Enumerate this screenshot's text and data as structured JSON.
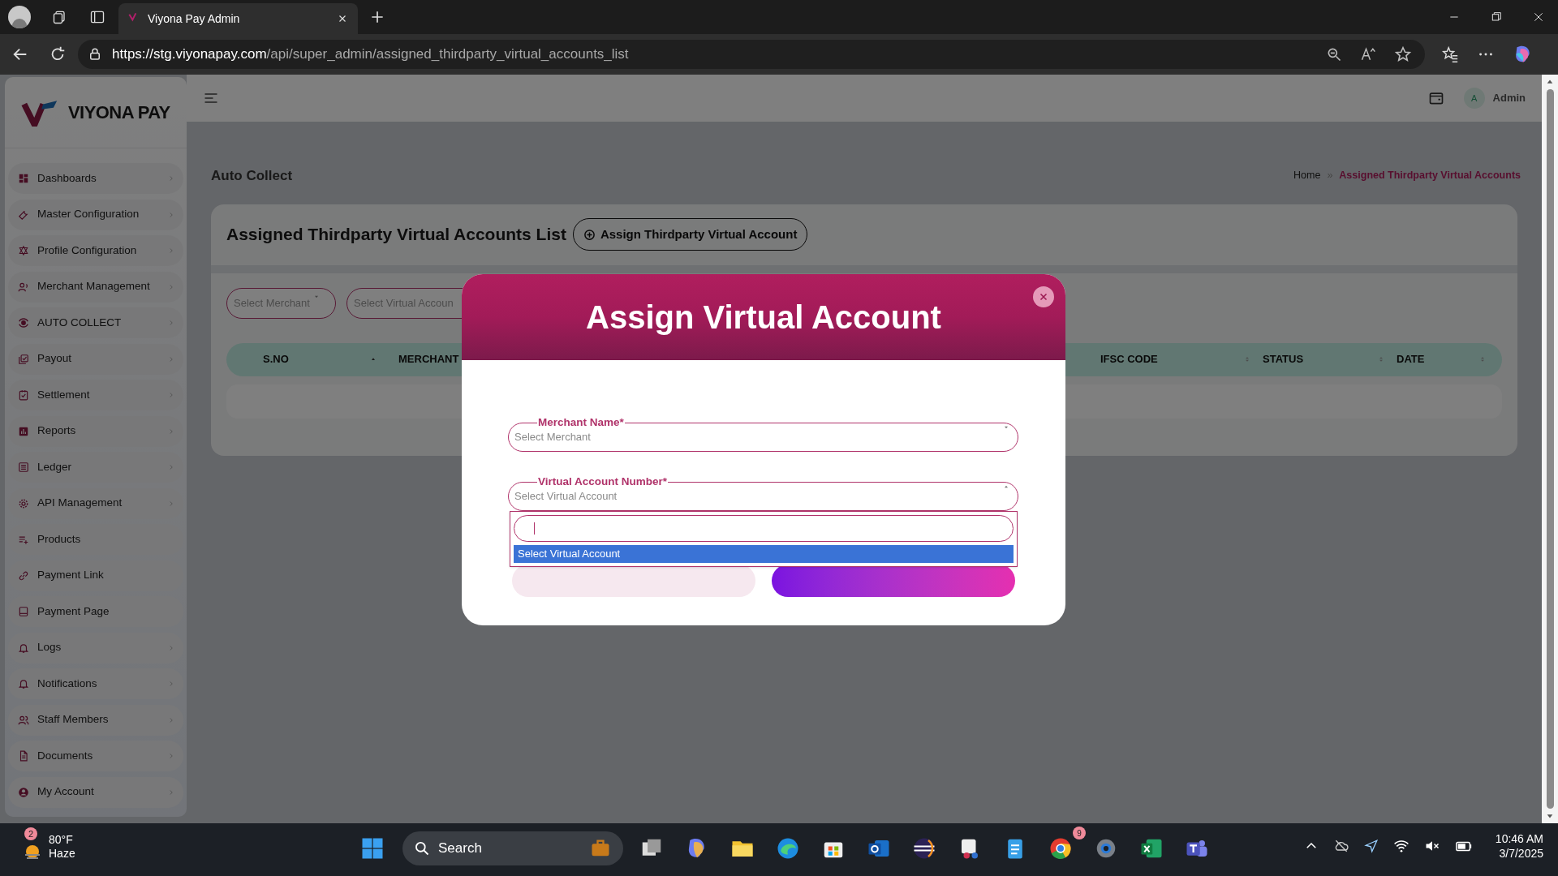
{
  "browser": {
    "tab_title": "Viyona Pay Admin",
    "url_host": "https://stg.viyonapay.com",
    "url_path": "/api/super_admin/assigned_thirdparty_virtual_accounts_list"
  },
  "sidebar": {
    "logo": "VIYONA PAY",
    "items": [
      {
        "label": "Dashboards",
        "has_submenu": true
      },
      {
        "label": "Master Configuration",
        "has_submenu": true
      },
      {
        "label": "Profile Configuration",
        "has_submenu": true
      },
      {
        "label": "Merchant Management",
        "has_submenu": true
      },
      {
        "label": "AUTO COLLECT",
        "has_submenu": true
      },
      {
        "label": "Payout",
        "has_submenu": true
      },
      {
        "label": "Settlement",
        "has_submenu": true
      },
      {
        "label": "Reports",
        "has_submenu": true
      },
      {
        "label": "Ledger",
        "has_submenu": true
      },
      {
        "label": "API Management",
        "has_submenu": true
      },
      {
        "label": "Products",
        "has_submenu": false
      },
      {
        "label": "Payment Link",
        "has_submenu": false
      },
      {
        "label": "Payment Page",
        "has_submenu": false
      },
      {
        "label": "Logs",
        "has_submenu": true
      },
      {
        "label": "Notifications",
        "has_submenu": true
      },
      {
        "label": "Staff Members",
        "has_submenu": true
      },
      {
        "label": "Documents",
        "has_submenu": true
      },
      {
        "label": "My Account",
        "has_submenu": true
      }
    ]
  },
  "header": {
    "avatar": "A",
    "user": "Admin"
  },
  "page": {
    "title": "Auto Collect",
    "breadcrumb": [
      "Home",
      "Assigned Thirdparty Virtual Accounts"
    ],
    "breadcrumb_separator": "»",
    "card_title": "Assigned Thirdparty Virtual Accounts List",
    "assign_button": "Assign Thirdparty Virtual Account",
    "filters": [
      {
        "placeholder": "Select Merchant"
      },
      {
        "placeholder": "Select Virtual Accoun"
      }
    ],
    "table": {
      "columns": [
        {
          "label": "S.NO",
          "sortable": true,
          "sorted": true
        },
        {
          "label": "MERCHANT"
        },
        {
          "label": "IFSC CODE",
          "sortable": true,
          "sorted": false
        },
        {
          "label": "STATUS",
          "sortable": true,
          "sorted": false
        },
        {
          "label": "DATE",
          "sortable": true,
          "sorted": false
        }
      ]
    }
  },
  "modal": {
    "title": "Assign Virtual Account",
    "fields": [
      {
        "label": "Merchant Name*",
        "placeholder": "Select Merchant",
        "expanded": false
      },
      {
        "label": "Virtual Account Number*",
        "placeholder": "Select Virtual Account",
        "expanded": true,
        "options": [
          {
            "label": "Select Virtual Account",
            "selected": true
          }
        ]
      }
    ]
  },
  "taskbar": {
    "weather": {
      "temperature": "80°F",
      "condition": "Haze",
      "badge": "2"
    },
    "search": "Search",
    "chrome_badge": "9",
    "time": "10:46 AM",
    "date": "3/7/2025"
  }
}
